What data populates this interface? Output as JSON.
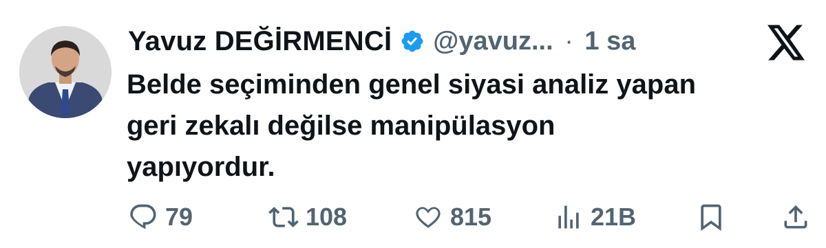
{
  "tweet": {
    "author_name": "Yavuz DEĞİRMENCİ",
    "handle": "@yavuz...",
    "separator": "·",
    "time": "1 sa",
    "text": "Belde seçiminden genel siyasi analiz yapan\ngeri zekalı değilse manipülasyon\nyapıyordur.",
    "verified_color": "#1d9bf0"
  },
  "icons": {
    "avatar": "avatar",
    "verified": "verified-badge-icon",
    "brand": "x-logo-icon",
    "reply": "reply-icon",
    "retweet": "retweet-icon",
    "like": "heart-icon",
    "views": "views-icon",
    "bookmark": "bookmark-icon",
    "share": "share-icon"
  },
  "actions": {
    "reply_count": "79",
    "retweet_count": "108",
    "like_count": "815",
    "views_count": "21B"
  }
}
